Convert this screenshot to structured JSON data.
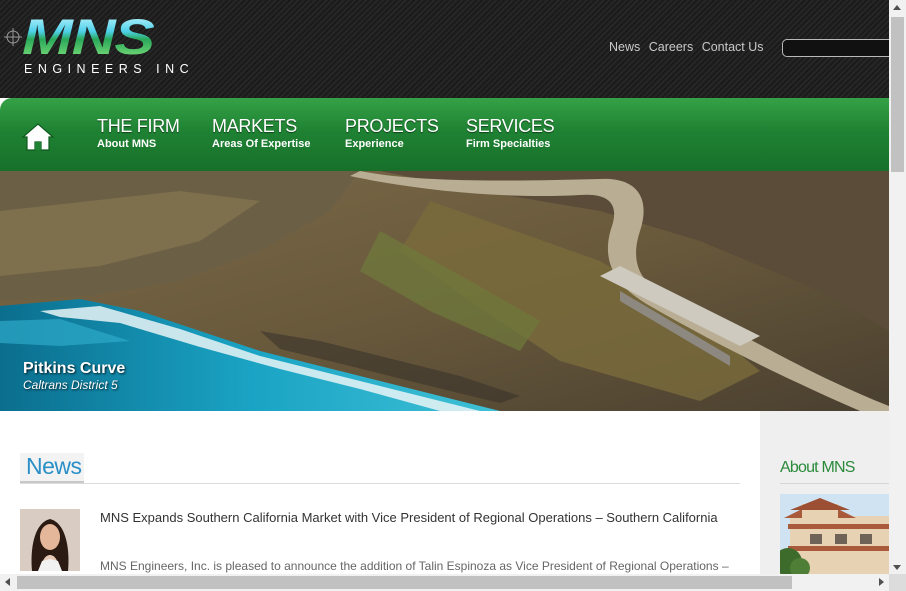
{
  "header": {
    "logo_text": "MNS",
    "logo_subtitle": "ENGINEERS   INC",
    "top_links": [
      "News",
      "Careers",
      "Contact Us"
    ],
    "search": {
      "value": "",
      "placeholder": ""
    }
  },
  "nav": {
    "home_icon": "home-icon",
    "items": [
      {
        "title": "THE FIRM",
        "sub": "About MNS"
      },
      {
        "title": "MARKETS",
        "sub": "Areas Of Expertise"
      },
      {
        "title": "PROJECTS",
        "sub": "Experience"
      },
      {
        "title": "SERVICES",
        "sub": "Firm Specialties"
      }
    ],
    "colors": {
      "top": "#35a146",
      "bottom": "#17702a"
    }
  },
  "hero": {
    "caption_title": "Pitkins Curve",
    "caption_subtitle": "Caltrans District 5"
  },
  "news": {
    "heading": "News",
    "article": {
      "title": "MNS Expands Southern California Market with Vice President of Regional Operations – Southern California",
      "excerpt": "MNS Engineers, Inc. is pleased to announce the addition of Talin Espinoza as Vice President of Regional Operations –"
    }
  },
  "sidebar": {
    "heading": "About MNS"
  },
  "theme": {
    "accent_blue": "#2a8fc6",
    "accent_green": "#2a8a3a",
    "header_bg": "#1b1b1b"
  }
}
